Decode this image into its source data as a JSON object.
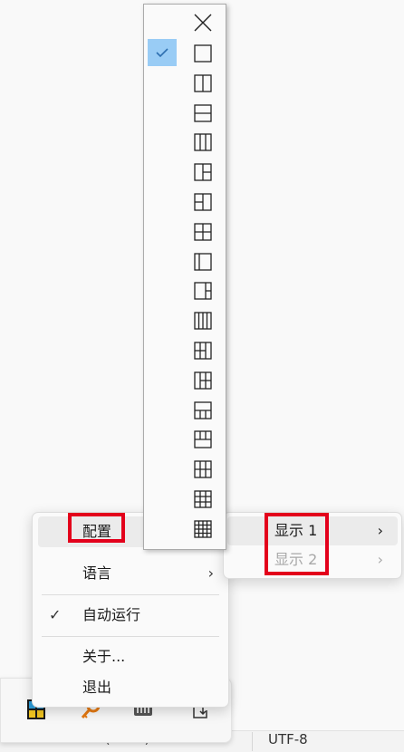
{
  "layout_panel": {
    "close_label": "close",
    "selected_index": 0,
    "layouts": [
      "single",
      "two-columns",
      "two-rows",
      "three-columns",
      "left-large-right-split",
      "right-split-left",
      "grid-2x2",
      "left-small-column",
      "right-small-column",
      "four-columns",
      "left-col-plus-grid",
      "right-col-plus-grid",
      "bottom-row-split",
      "top-row-split",
      "grid-3-plus",
      "grid-3x2",
      "grid-3x3"
    ]
  },
  "context_menu": {
    "config_label": "配置",
    "language_label": "语言",
    "autorun_label": "自动运行",
    "autorun_checked": true,
    "about_label": "关于...",
    "exit_label": "退出"
  },
  "submenu": {
    "display1_label": "显示 1",
    "display2_label": "显示 2"
  },
  "statusbar": {
    "line_ending": "Windows (CRLF)",
    "encoding": "UTF-8"
  },
  "colors": {
    "highlight_red": "#e3001b",
    "selection_blue": "#99ccf5"
  }
}
